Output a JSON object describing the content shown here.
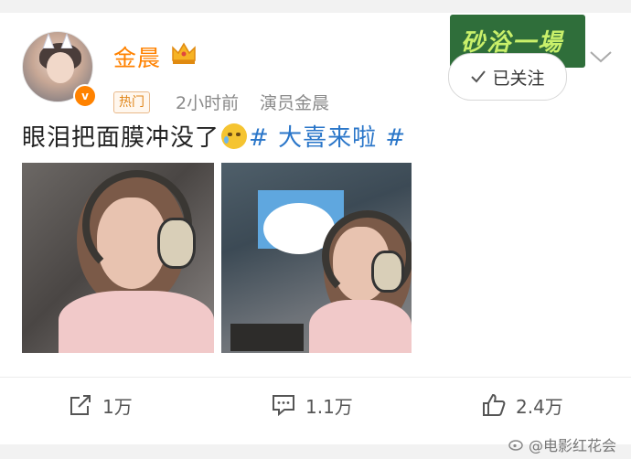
{
  "post": {
    "author": "金晨",
    "hot_tag": "热门",
    "time": "2小时前",
    "source": "演员金晨",
    "follow_label": "已关注",
    "banner_text": "砂浴一場",
    "text_main": "眼泪把面膜冲没了",
    "hashtag": "# 大喜来啦 #",
    "emoji": "crying-face-icon",
    "images": [
      "photo-1",
      "photo-2"
    ]
  },
  "actions": {
    "share_count": "1万",
    "comment_count": "1.1万",
    "like_count": "2.4万"
  },
  "watermark": {
    "text": "@电影红花会"
  },
  "colors": {
    "username": "#ff8200",
    "hashtag": "#2a76c9",
    "meta": "#8a8a8a",
    "background": "#f2f2f2"
  }
}
